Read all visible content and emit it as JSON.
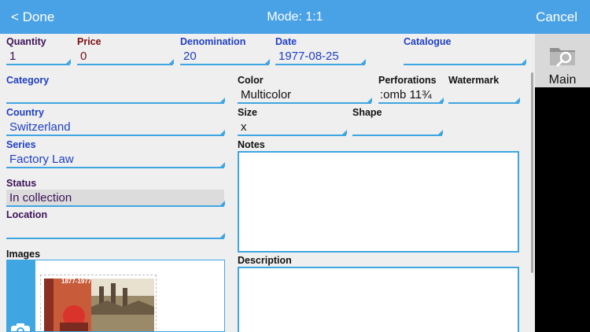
{
  "topbar": {
    "done_label": "< Done",
    "title": "Mode: 1:1",
    "cancel_label": "Cancel"
  },
  "fields": {
    "quantity": {
      "label": "Quantity",
      "value": "1"
    },
    "price": {
      "label": "Price",
      "value": "0"
    },
    "denomination": {
      "label": "Denomination",
      "value": "20"
    },
    "date": {
      "label": "Date",
      "value": "1977-08-25"
    },
    "catalogue": {
      "label": "Catalogue",
      "value": ""
    },
    "category": {
      "label": "Category",
      "value": ""
    },
    "color": {
      "label": "Color",
      "value": "Multicolor"
    },
    "perforations": {
      "label": "Perforations",
      "value": ":omb 11¾"
    },
    "watermark": {
      "label": "Watermark",
      "value": ""
    },
    "country": {
      "label": "Country",
      "value": "Switzerland"
    },
    "size": {
      "label": "Size",
      "value": "x"
    },
    "shape": {
      "label": "Shape",
      "value": ""
    },
    "series": {
      "label": "Series",
      "value": "Factory Law"
    },
    "notes": {
      "label": "Notes"
    },
    "status": {
      "label": "Status",
      "value": "In collection"
    },
    "location": {
      "label": "Location",
      "value": ""
    },
    "images": {
      "label": "Images"
    },
    "description": {
      "label": "Description"
    }
  },
  "stamp": {
    "years": "1877-1977",
    "country_fragment": "VETIA"
  },
  "sidepanel": {
    "main_label": "Main"
  },
  "colors": {
    "accent": "#4aa2e6",
    "field_underline": "#3fa6e2",
    "label_red": "#7a0f16",
    "label_blue": "#1f3fc4",
    "label_purple": "#3c1258"
  },
  "icons": {
    "camera": "camera-icon",
    "folder": "folder-search-icon"
  }
}
